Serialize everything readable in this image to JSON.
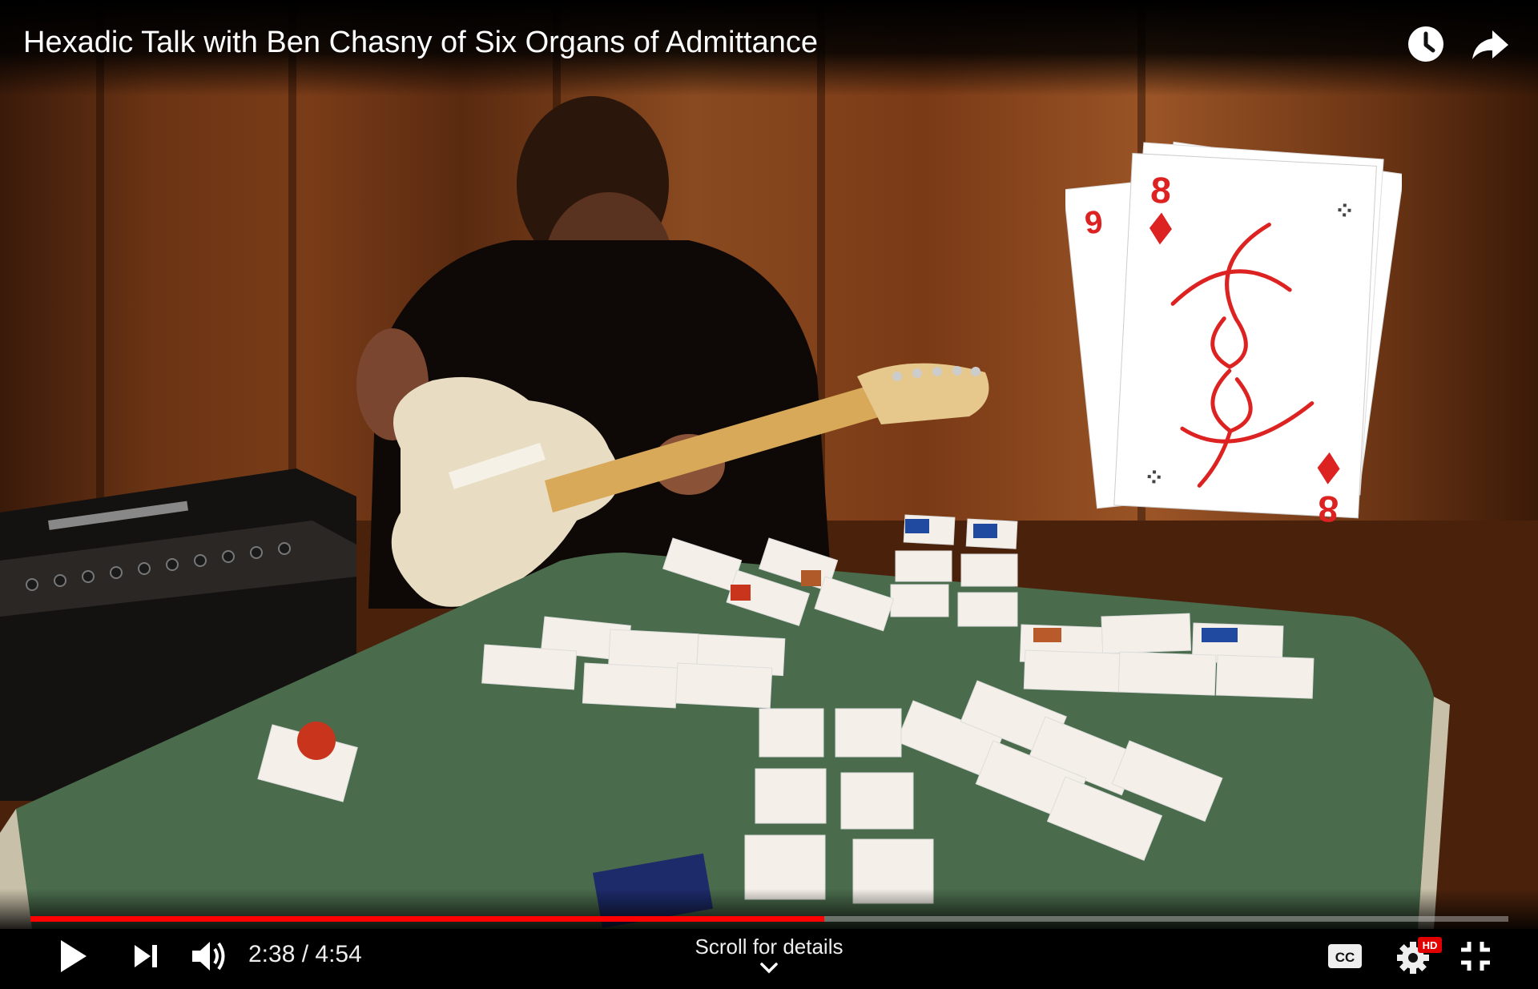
{
  "video": {
    "title": "Hexadic Talk with Ben Chasny of Six Organs of Admittance"
  },
  "top_actions": [
    {
      "name": "watch-later-icon"
    },
    {
      "name": "share-icon"
    }
  ],
  "controls": {
    "current_time": "2:38",
    "duration": "4:54",
    "time_display": "2:38 / 4:54",
    "progress_fraction": 0.537,
    "scroll_hint": "Scroll for details",
    "icons": [
      "play-icon",
      "next-icon",
      "volume-icon",
      "captions-icon",
      "settings-icon",
      "exit-fullscreen-icon"
    ],
    "settings_badge": "HD"
  },
  "overlay_card": {
    "rank_primary": "8",
    "rank_behind": "9",
    "suit": "diamond"
  },
  "colors": {
    "progress_played": "#ff0000",
    "hd_badge": "#e00000",
    "table_felt": "#4a6b4c"
  }
}
